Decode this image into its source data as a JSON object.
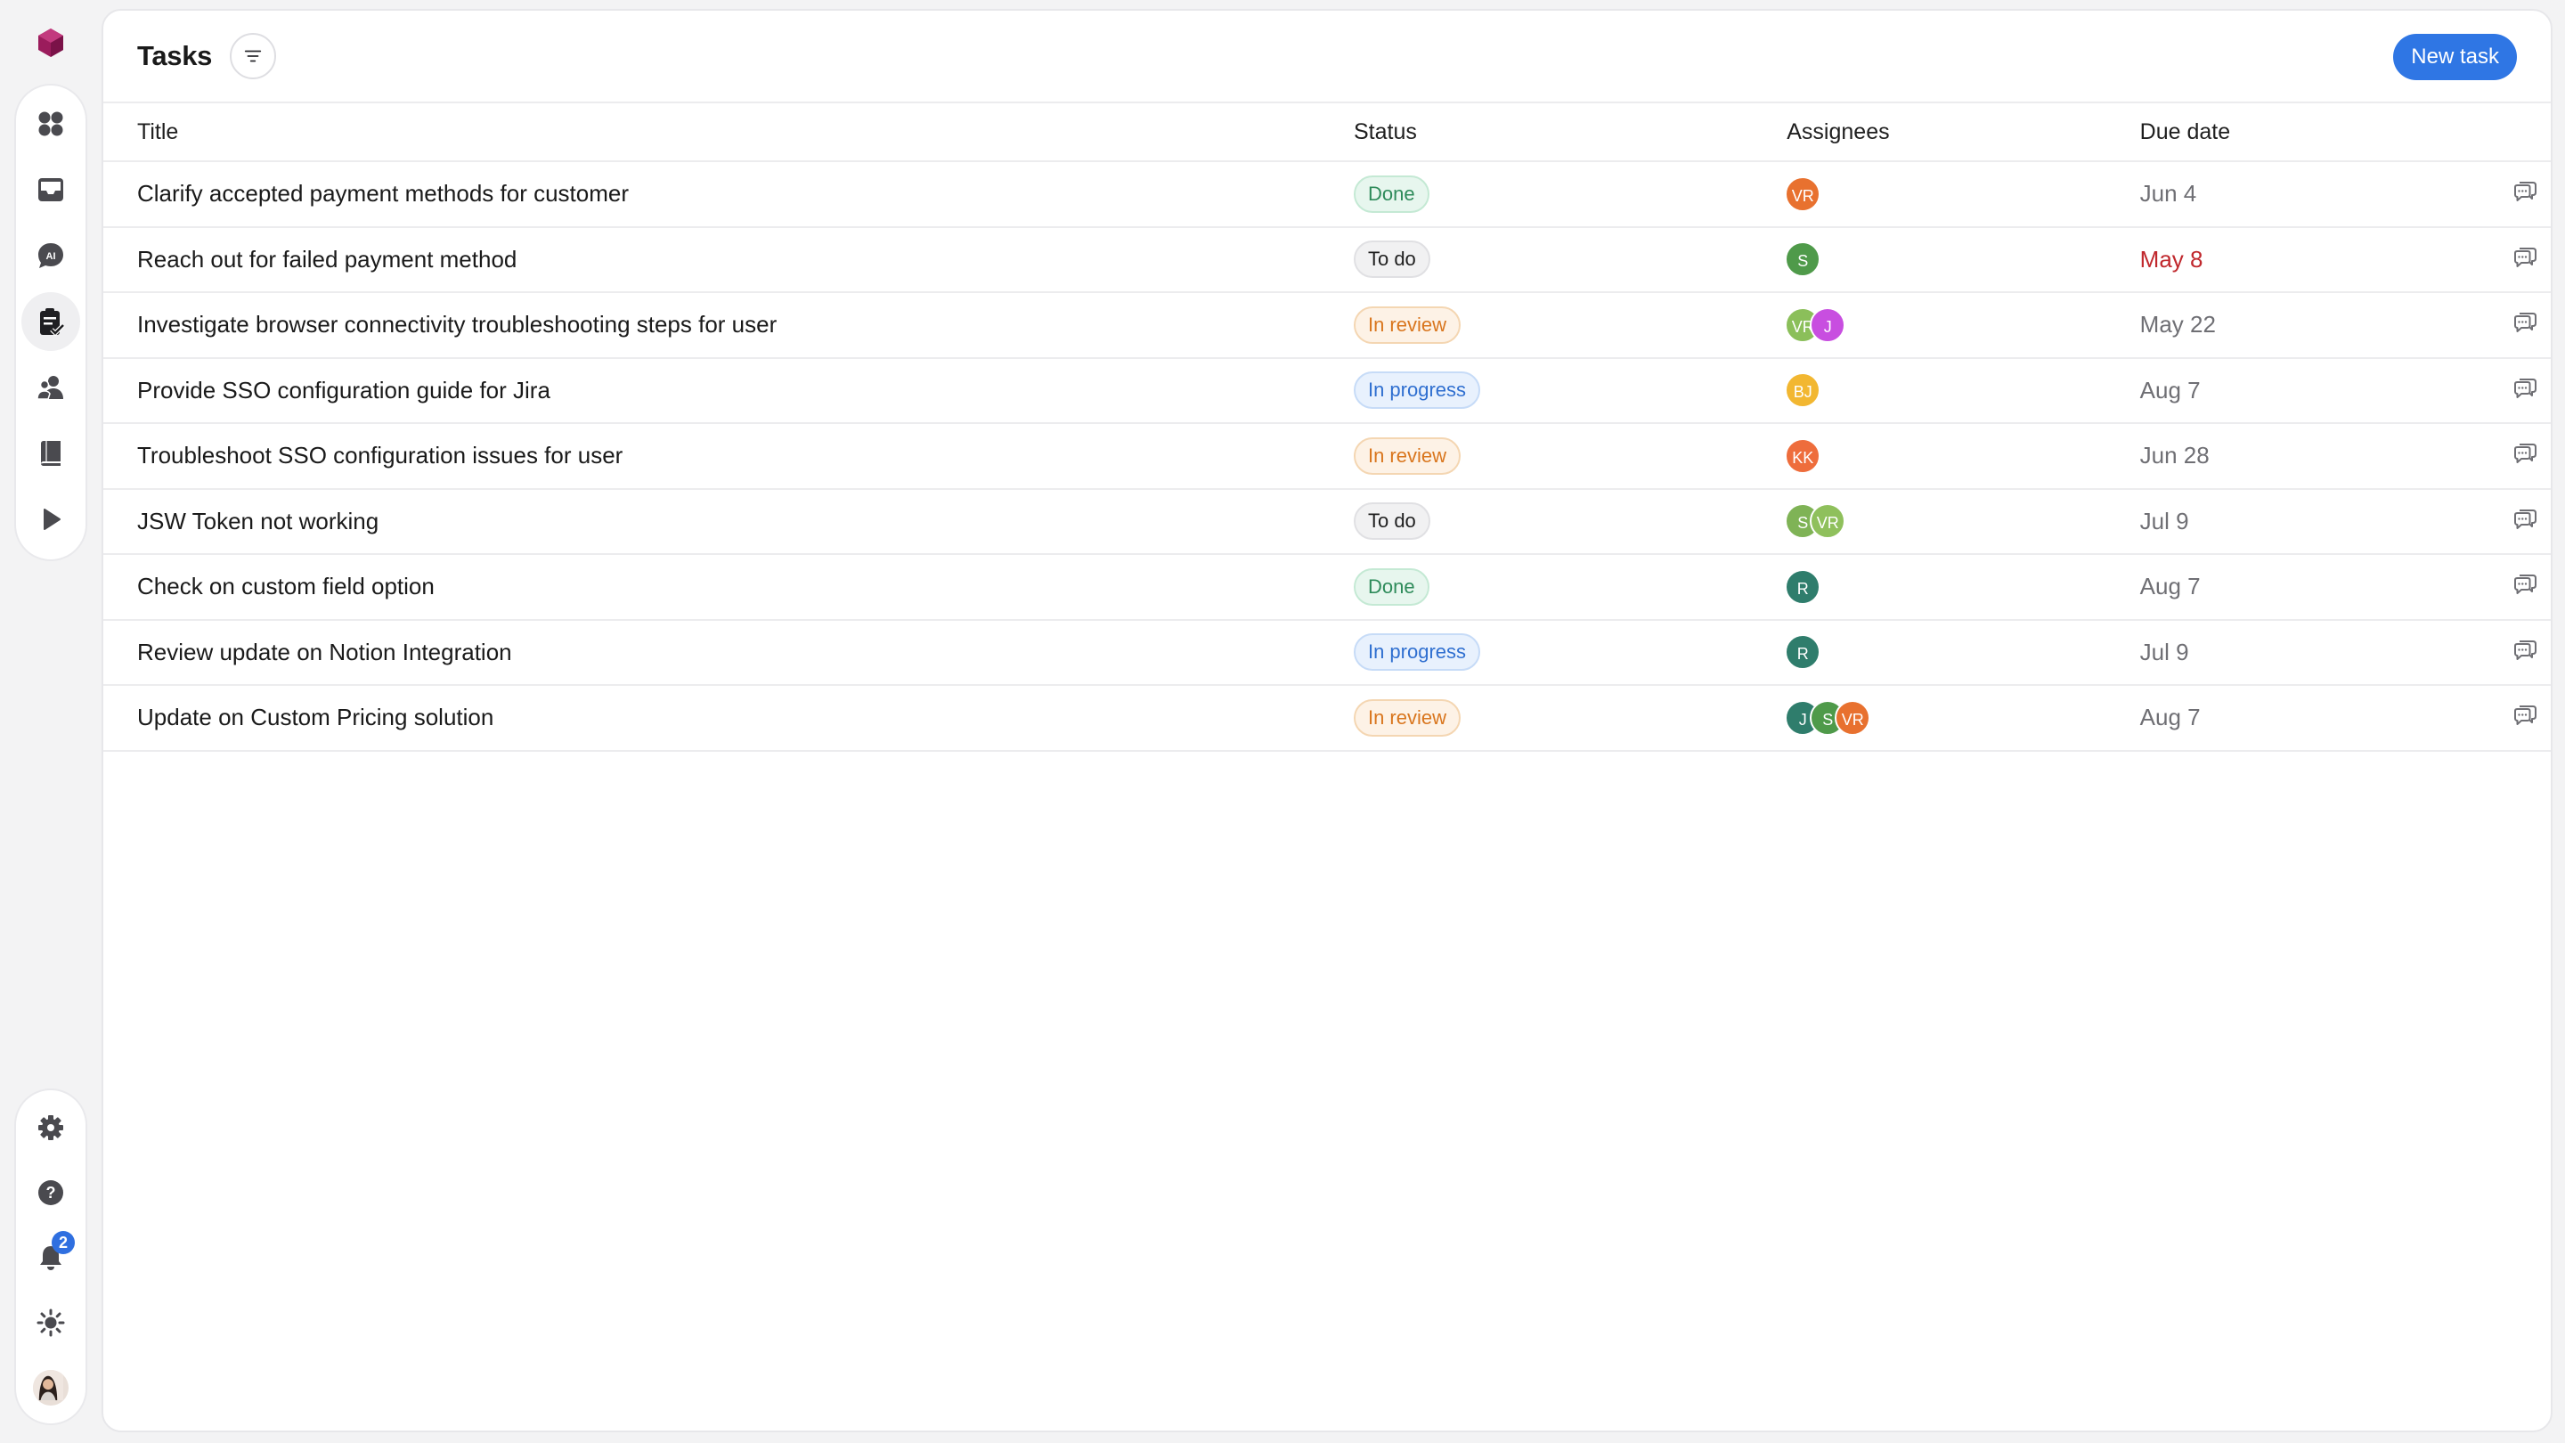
{
  "app": {
    "page_title": "Tasks",
    "new_task_label": "New task",
    "brand_color": "#9b1c5c",
    "accent_color": "#2f76e4"
  },
  "sidebar": {
    "top_items": [
      {
        "icon": "dashboard-icon",
        "active": false
      },
      {
        "icon": "inbox-icon",
        "active": false
      },
      {
        "icon": "ai-chat-icon",
        "active": false
      },
      {
        "icon": "tasks-clipboard-icon",
        "active": true
      },
      {
        "icon": "contacts-icon",
        "active": false
      },
      {
        "icon": "knowledge-book-icon",
        "active": false
      },
      {
        "icon": "play-icon",
        "active": false
      }
    ],
    "bottom_items": [
      {
        "icon": "gear-icon"
      },
      {
        "icon": "help-icon"
      },
      {
        "icon": "bell-icon",
        "badge": "2"
      },
      {
        "icon": "sun-icon"
      },
      {
        "icon": "user-avatar"
      }
    ]
  },
  "table": {
    "headers": {
      "title": "Title",
      "status": "Status",
      "assignees": "Assignees",
      "due": "Due date"
    },
    "rows": [
      {
        "title": "Clarify accepted payment methods for customer",
        "status": "Done",
        "status_kind": "done",
        "assignees": [
          {
            "initials": "VR",
            "color": "#e8712f"
          }
        ],
        "due": "Jun 4",
        "overdue": false
      },
      {
        "title": "Reach out for failed payment method",
        "status": "To do",
        "status_kind": "todo",
        "assignees": [
          {
            "initials": "S",
            "color": "#4f9a4a"
          }
        ],
        "due": "May 8",
        "overdue": true
      },
      {
        "title": "Investigate browser connectivity troubleshooting steps for user",
        "status": "In review",
        "status_kind": "review",
        "assignees": [
          {
            "initials": "VR",
            "color": "#8bbf5a"
          },
          {
            "initials": "J",
            "color": "#c84ee0"
          }
        ],
        "due": "May 22",
        "overdue": false
      },
      {
        "title": "Provide SSO configuration guide for Jira",
        "status": "In progress",
        "status_kind": "progress",
        "assignees": [
          {
            "initials": "BJ",
            "color": "#f2b731"
          }
        ],
        "due": "Aug 7",
        "overdue": false
      },
      {
        "title": "Troubleshoot SSO configuration issues for user",
        "status": "In review",
        "status_kind": "review",
        "assignees": [
          {
            "initials": "KK",
            "color": "#ee6d3c"
          }
        ],
        "due": "Jun 28",
        "overdue": false
      },
      {
        "title": "JSW Token not working",
        "status": "To do",
        "status_kind": "todo",
        "assignees": [
          {
            "initials": "S",
            "color": "#7fb356"
          },
          {
            "initials": "VR",
            "color": "#8fc05c"
          }
        ],
        "due": "Jul 9",
        "overdue": false
      },
      {
        "title": "Check on custom field option",
        "status": "Done",
        "status_kind": "done",
        "assignees": [
          {
            "initials": "R",
            "color": "#2f7d6c"
          }
        ],
        "due": "Aug 7",
        "overdue": false
      },
      {
        "title": "Review update on Notion Integration",
        "status": "In progress",
        "status_kind": "progress",
        "assignees": [
          {
            "initials": "R",
            "color": "#2f7d6c"
          }
        ],
        "due": "Jul 9",
        "overdue": false
      },
      {
        "title": "Update on Custom Pricing solution",
        "status": "In review",
        "status_kind": "review",
        "assignees": [
          {
            "initials": "J",
            "color": "#2f7d6c"
          },
          {
            "initials": "S",
            "color": "#4f9a4a"
          },
          {
            "initials": "VR",
            "color": "#e8712f"
          }
        ],
        "due": "Aug 7",
        "overdue": false
      }
    ]
  }
}
